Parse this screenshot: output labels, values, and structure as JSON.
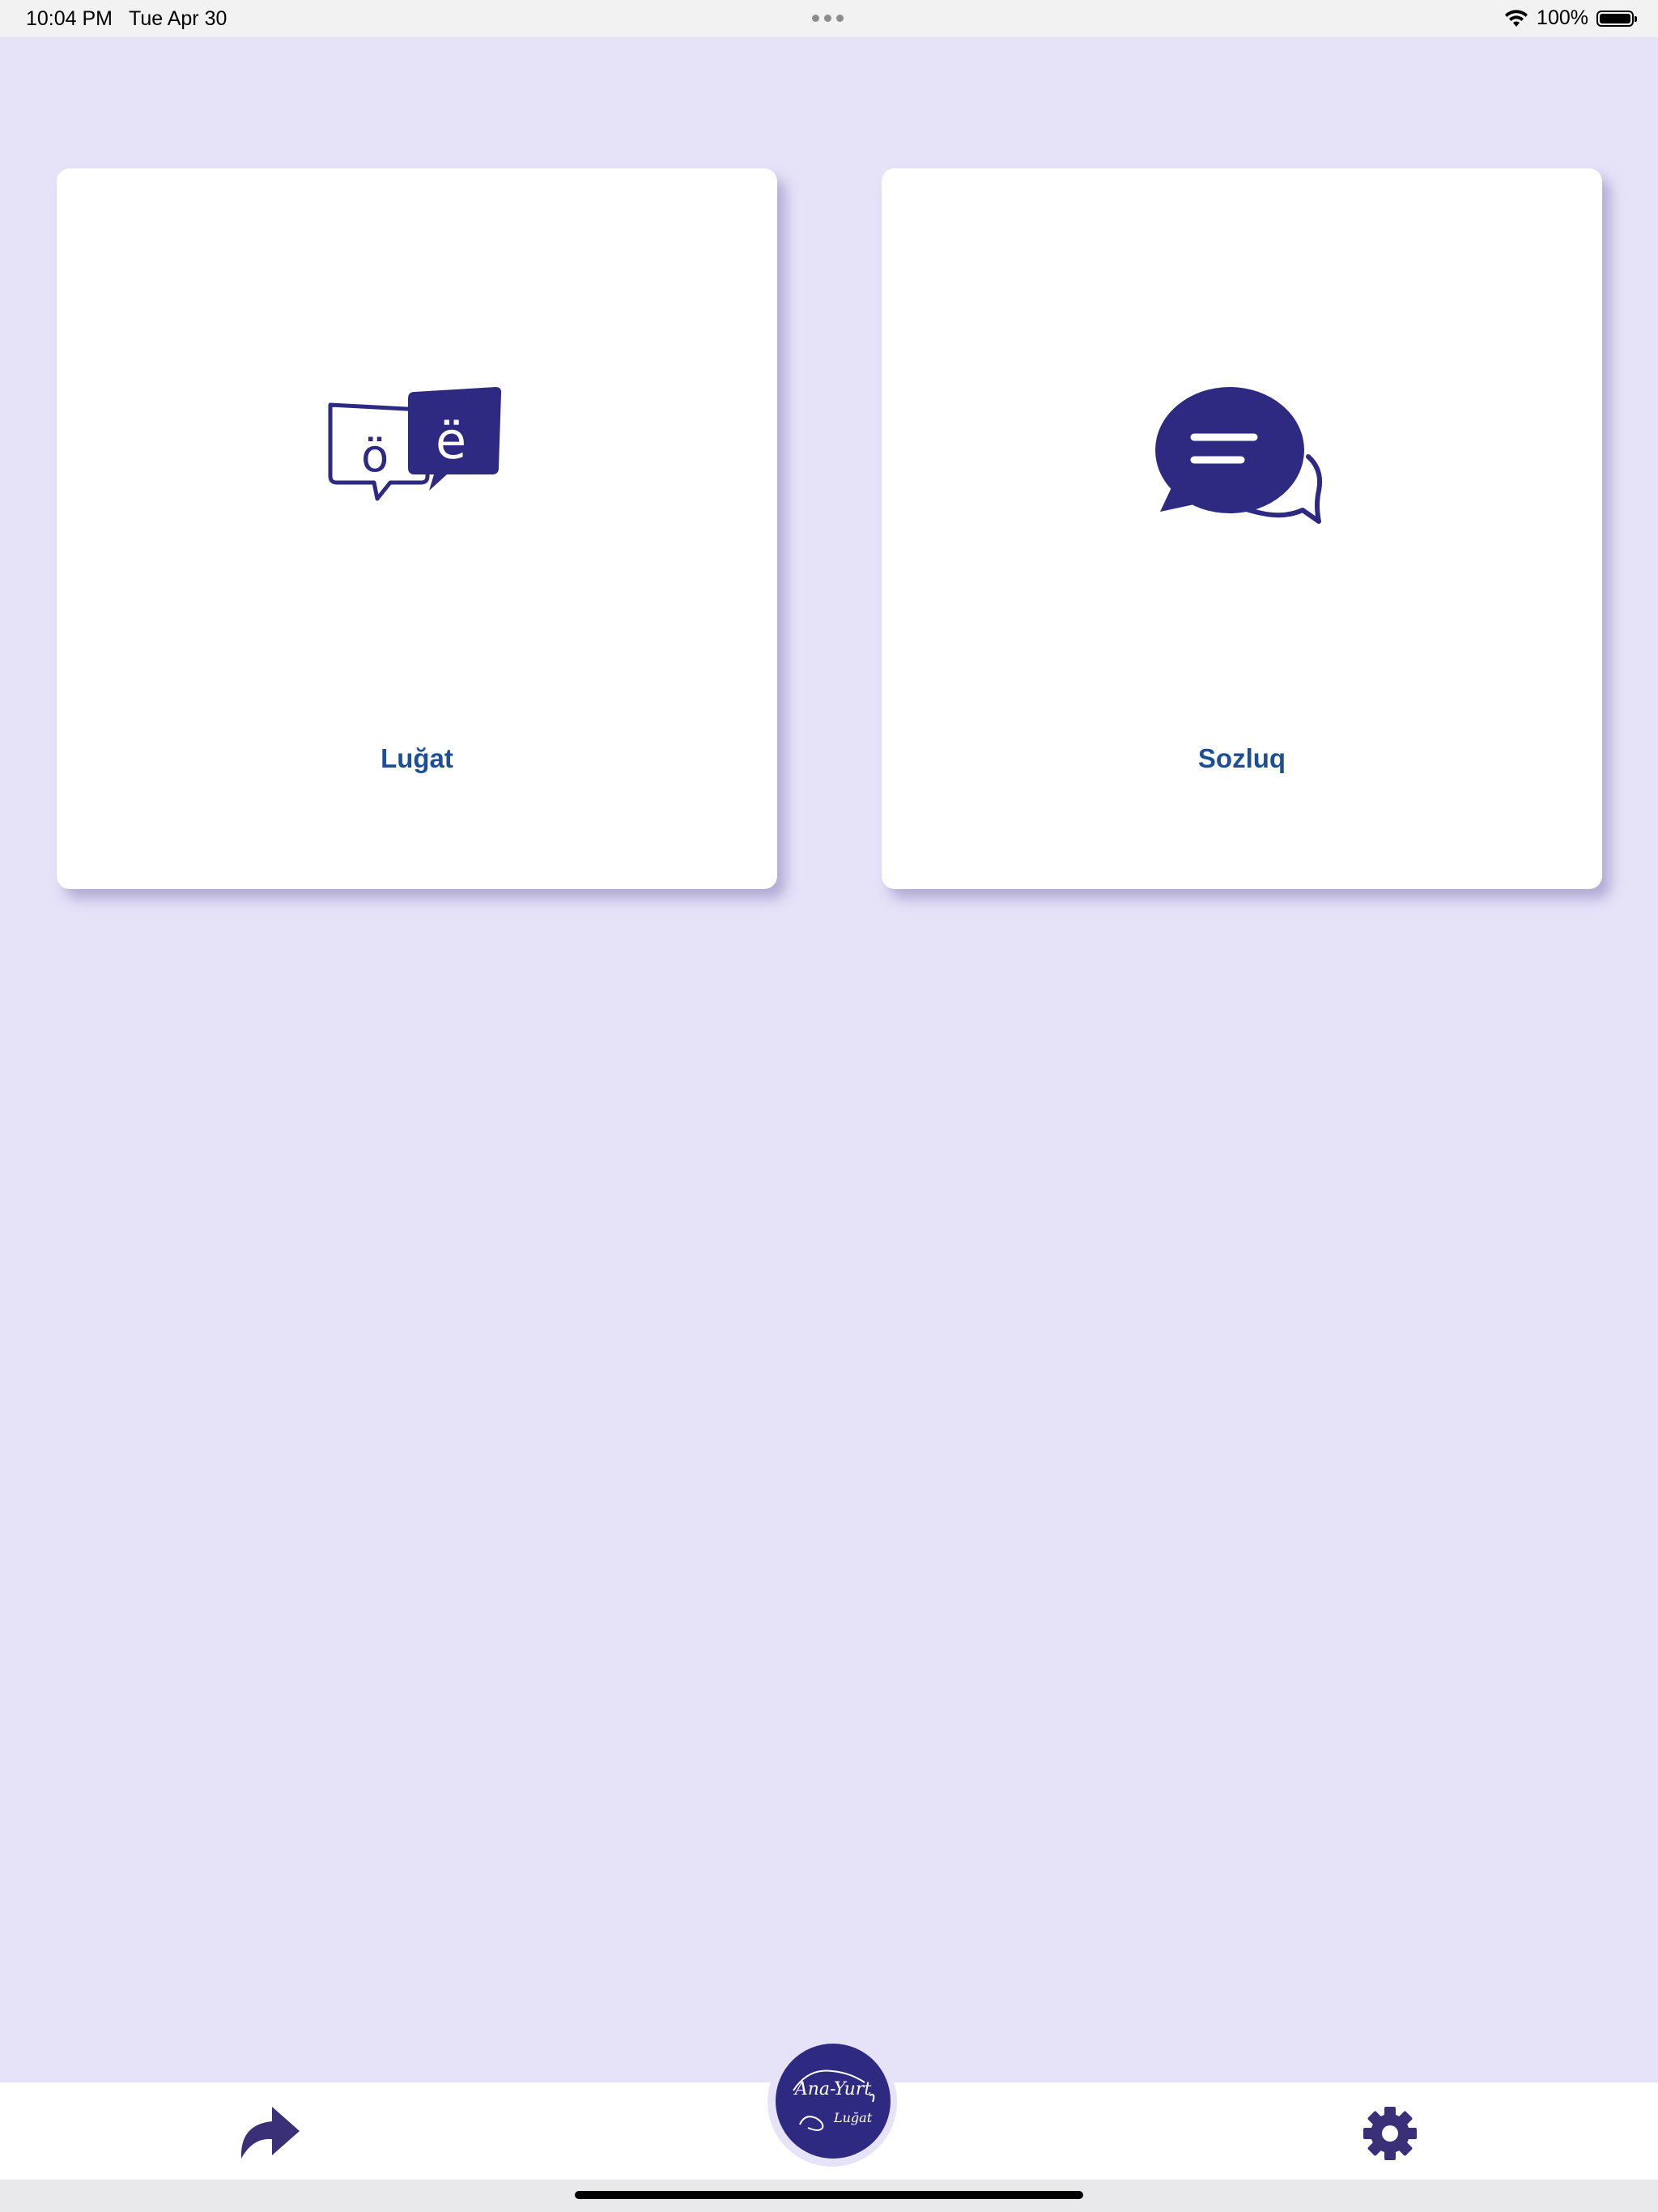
{
  "status_bar": {
    "time": "10:04 PM",
    "date": "Tue Apr 30",
    "battery": "100%",
    "battery_level": 1.0
  },
  "cards": [
    {
      "label": "Luğat",
      "icon": "chat-letters-icon",
      "bubble_letters": [
        "ö",
        "ë"
      ]
    },
    {
      "label": "Sozluq",
      "icon": "chat-bubbles-icon"
    }
  ],
  "bottom_bar": {
    "share_icon": "share-arrow-icon",
    "settings_icon": "gear-icon",
    "logo": {
      "title": "Ana-Yurt",
      "subtitle": "Luğat"
    }
  },
  "colors": {
    "background": "#e6e2f8",
    "accent": "#2e2a82",
    "label": "#1e4f96",
    "card": "#ffffff"
  }
}
